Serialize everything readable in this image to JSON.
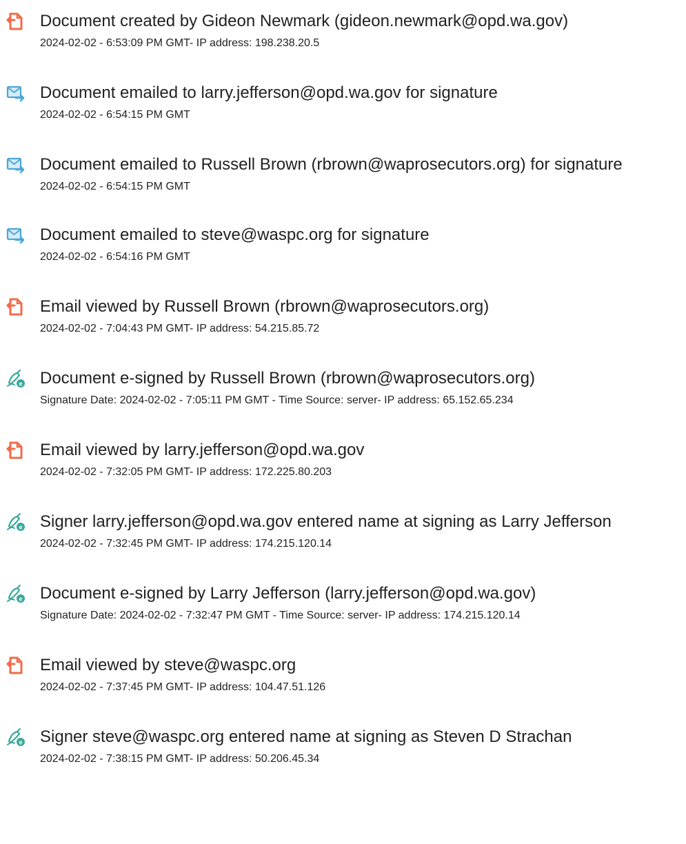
{
  "colors": {
    "doc_icon": "#f26b4a",
    "email_icon": "#4aa7d8",
    "esign_icon": "#3aa89a"
  },
  "events": [
    {
      "icon": "document-icon",
      "title": "Document created by Gideon Newmark (gideon.newmark@opd.wa.gov)",
      "detail": "2024-02-02 - 6:53:09 PM GMT- IP address: 198.238.20.5"
    },
    {
      "icon": "email-icon",
      "title": "Document emailed to larry.jefferson@opd.wa.gov for signature",
      "detail": "2024-02-02 - 6:54:15 PM GMT"
    },
    {
      "icon": "email-icon",
      "title": "Document emailed to Russell Brown (rbrown@waprosecutors.org) for signature",
      "detail": "2024-02-02 - 6:54:15 PM GMT"
    },
    {
      "icon": "email-icon",
      "title": "Document emailed to steve@waspc.org for signature",
      "detail": "2024-02-02 - 6:54:16 PM GMT"
    },
    {
      "icon": "document-icon",
      "title": "Email viewed by Russell Brown (rbrown@waprosecutors.org)",
      "detail": "2024-02-02 - 7:04:43 PM GMT- IP address: 54.215.85.72"
    },
    {
      "icon": "esign-icon",
      "title": "Document e-signed by Russell Brown (rbrown@waprosecutors.org)",
      "detail": "Signature Date: 2024-02-02 - 7:05:11 PM GMT - Time Source: server- IP address: 65.152.65.234"
    },
    {
      "icon": "document-icon",
      "title": "Email viewed by larry.jefferson@opd.wa.gov",
      "detail": "2024-02-02 - 7:32:05 PM GMT- IP address: 172.225.80.203"
    },
    {
      "icon": "esign-icon",
      "title": "Signer larry.jefferson@opd.wa.gov entered name at signing as Larry Jefferson",
      "detail": "2024-02-02 - 7:32:45 PM GMT- IP address: 174.215.120.14"
    },
    {
      "icon": "esign-icon",
      "title": "Document e-signed by Larry Jefferson (larry.jefferson@opd.wa.gov)",
      "detail": "Signature Date: 2024-02-02 - 7:32:47 PM GMT - Time Source: server- IP address: 174.215.120.14"
    },
    {
      "icon": "document-icon",
      "title": "Email viewed by steve@waspc.org",
      "detail": "2024-02-02 - 7:37:45 PM GMT- IP address: 104.47.51.126"
    },
    {
      "icon": "esign-icon",
      "title": "Signer steve@waspc.org entered name at signing as Steven D Strachan",
      "detail": "2024-02-02 - 7:38:15 PM GMT- IP address: 50.206.45.34"
    }
  ]
}
